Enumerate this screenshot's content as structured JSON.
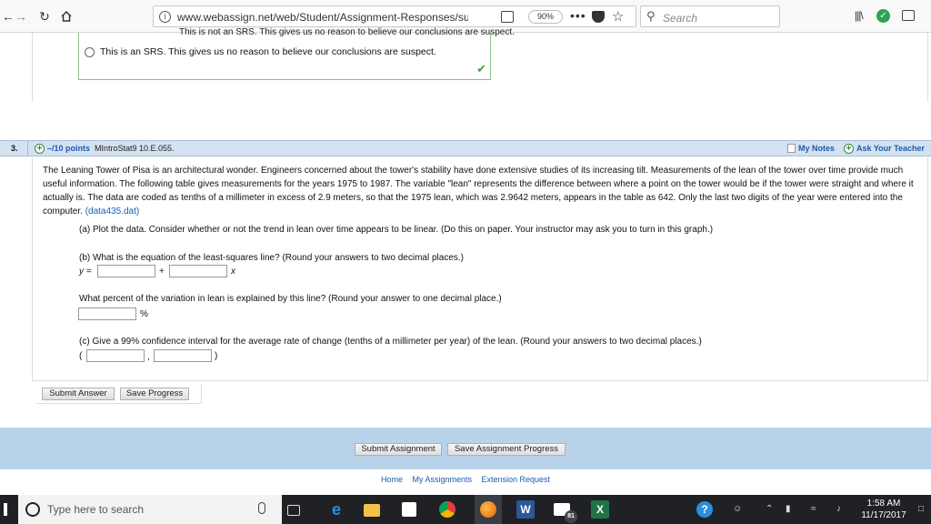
{
  "browser": {
    "url_main": "www.webassign.net/web/Student/Assignment-Responses/sub",
    "url_fade": "mi",
    "zoom": "90%",
    "search_placeholder": "Search"
  },
  "previous": {
    "cut_text": "This is not an SRS. This gives us no reason to believe our conclusions are suspect.",
    "option_text": "This is an SRS. This gives us no reason to believe our conclusions are suspect."
  },
  "question": {
    "number": "3.",
    "points": "–/10 points",
    "source": "MIntroStat9 10.E.055.",
    "my_notes": "My Notes",
    "ask_teacher": "Ask Your Teacher",
    "paragraph": "The Leaning Tower of Pisa is an architectural wonder. Engineers concerned about the tower's stability have done extensive studies of its increasing tilt. Measurements of the lean of the tower over time provide much useful information. The following table gives measurements for the years 1975 to 1987. The variable \"lean\" represents the difference between where a point on the tower would be if the tower were straight and where it actually is. The data are coded as tenths of a millimeter in excess of 2.9 meters, so that the 1975 lean, which was 2.9642 meters, appears in the table as 642. Only the last two digits of the year were entered into the computer.",
    "data_link": "(data435.dat)",
    "part_a": "(a) Plot the data. Consider whether or not the trend in lean over time appears to be linear. (Do this on paper. Your instructor may ask you to turn in this graph.)",
    "part_b": "(b) What is the equation of the least-squares line? (Round your answers to two decimal places.)",
    "y_eq": "y =",
    "plus": "+",
    "x_var": "x",
    "variation_q": "What percent of the variation in lean is explained by this line? (Round your answer to one decimal place.)",
    "percent": "%",
    "part_c": "(c) Give a 99% confidence interval for the average rate of change (tenths of a millimeter per year) of the lean. (Round your answers to two decimal places.)",
    "open_paren": "(",
    "comma": ",",
    "close_paren": ")",
    "submit_answer": "Submit Answer",
    "save_progress": "Save Progress"
  },
  "footer": {
    "submit_assignment": "Submit Assignment",
    "save_assignment_progress": "Save Assignment Progress",
    "links": [
      "Home",
      "My Assignments",
      "Extension Request"
    ]
  },
  "taskbar": {
    "search_placeholder": "Type here to search",
    "time": "1:58 AM",
    "date": "11/17/2017",
    "mail_badge": "81"
  }
}
